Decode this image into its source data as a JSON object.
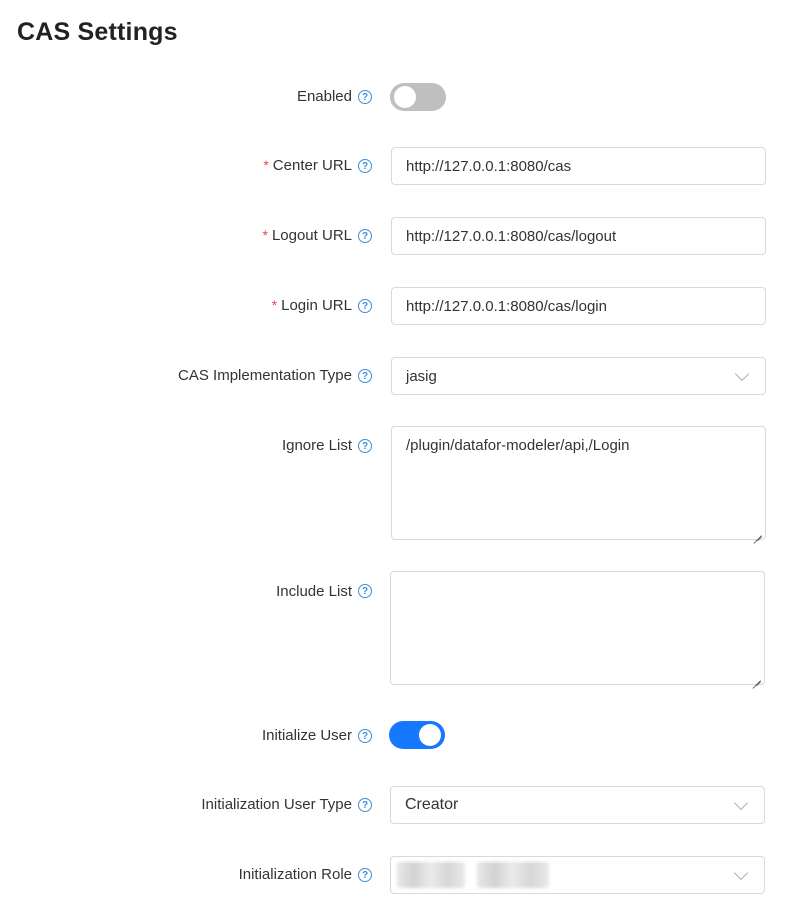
{
  "page": {
    "title": "CAS Settings"
  },
  "form": {
    "enabled": {
      "label": "Enabled",
      "value": false
    },
    "center_url": {
      "label": "Center URL",
      "value": "http://127.0.0.1:8080/cas"
    },
    "logout_url": {
      "label": "Logout URL",
      "value": "http://127.0.0.1:8080/cas/logout"
    },
    "login_url": {
      "label": "Login URL",
      "value": "http://127.0.0.1:8080/cas/login"
    },
    "impl_type": {
      "label": "CAS Implementation Type",
      "value": "jasig"
    },
    "ignore_list": {
      "label": "Ignore List",
      "value": "/plugin/datafor-modeler/api,/Login"
    },
    "include_list": {
      "label": "Include List",
      "value": ""
    },
    "initialize_user": {
      "label": "Initialize User",
      "value": true
    },
    "init_user_type": {
      "label": "Initialization User Type",
      "value": "Creator"
    },
    "init_role": {
      "label": "Initialization Role"
    }
  },
  "ui": {
    "required_mark": "*",
    "help_glyph": "?"
  },
  "colors": {
    "accent": "#1677ff",
    "required": "#e5484d",
    "help": "#3b8fd9",
    "toggle_off": "#bfbfbf"
  }
}
